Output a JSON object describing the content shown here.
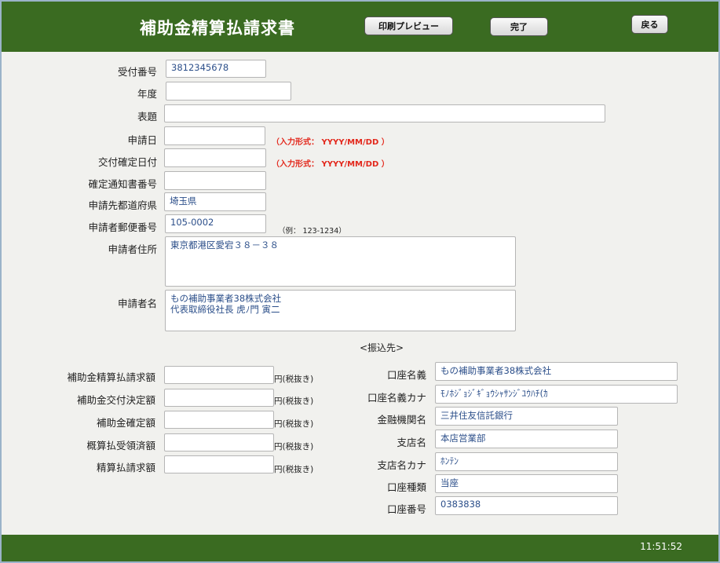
{
  "header": {
    "title": "補助金精算払請求書",
    "print_preview": "印刷プレビュー",
    "complete": "完了",
    "back": "戻る"
  },
  "form": {
    "receipt_no": {
      "label": "受付番号",
      "value": "3812345678"
    },
    "fiscal_year": {
      "label": "年度",
      "value": ""
    },
    "subject": {
      "label": "表題",
      "value": ""
    },
    "application_date": {
      "label": "申請日",
      "value": "",
      "hint": "（入力形式： YYYY/MM/DD ）"
    },
    "decision_date": {
      "label": "交付確定日付",
      "value": "",
      "hint": "（入力形式： YYYY/MM/DD ）"
    },
    "notice_no": {
      "label": "確定通知書番号",
      "value": ""
    },
    "prefecture": {
      "label": "申請先都道府県",
      "value": "埼玉県"
    },
    "postal_code": {
      "label": "申請者郵便番号",
      "value": "105-0002",
      "hint": "（例： 123-1234）"
    },
    "address": {
      "label": "申請者住所",
      "value": "東京都港区愛宕３８－３８"
    },
    "applicant_name": {
      "label": "申請者名",
      "value": "もの補助事業者38株式会社\n代表取締役社長 虎ﾉ門 寅二"
    }
  },
  "section_title": "<振込先>",
  "amounts": {
    "unit": "円(税抜き)",
    "items": [
      {
        "label": "補助金精算払請求額",
        "value": ""
      },
      {
        "label": "補助金交付決定額",
        "value": ""
      },
      {
        "label": "補助金確定額",
        "value": ""
      },
      {
        "label": "概算払受領済額",
        "value": ""
      },
      {
        "label": "精算払請求額",
        "value": ""
      }
    ]
  },
  "bank": {
    "items": [
      {
        "label": "口座名義",
        "value": "もの補助事業者38株式会社"
      },
      {
        "label": "口座名義カナ",
        "value": "ﾓﾉﾎｼﾞｮｼﾞｷﾞｮｳｼｬｻﾝｼﾞﾕｳﾊﾁ(ｶ"
      },
      {
        "label": "金融機関名",
        "value": "三井住友信託銀行"
      },
      {
        "label": "支店名",
        "value": "本店営業部"
      },
      {
        "label": "支店名カナ",
        "value": "ﾎﾝﾃﾝ"
      },
      {
        "label": "口座種類",
        "value": "当座"
      },
      {
        "label": "口座番号",
        "value": "0383838"
      }
    ]
  },
  "footer": {
    "time": "11:51:52"
  }
}
